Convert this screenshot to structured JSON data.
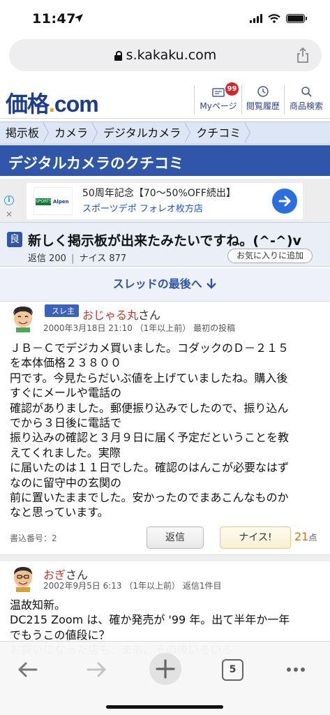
{
  "status": {
    "time": "11:47"
  },
  "browser": {
    "url": "s.kakaku.com",
    "tab_count": "5"
  },
  "site": {
    "logo_kanji": "価格",
    "logo_dot": ".",
    "logo_com": "com",
    "mypage_label": "Myページ",
    "mypage_badge": "99",
    "history_label": "閲覧履歴",
    "search_label": "商品検索"
  },
  "breadcrumb": [
    "掲示板",
    "カメラ",
    "デジタルカメラ",
    "クチコミ"
  ],
  "page_title": "デジタルカメラのクチコミ",
  "ad": {
    "line1": "50周年記念【70〜50%OFF続出】",
    "line2": "スポーツデポ フォレオ枚方店",
    "thumb_left": "SPORTS DEPO",
    "thumb_right": "Alpen"
  },
  "thread": {
    "tag": "良",
    "title": "新しく掲示板が出来たみたいですね。(^-^)v",
    "replies": "返信 200",
    "sep": "|",
    "nice": "ナイス 877",
    "fav_button": "お気に入りに追加"
  },
  "jump_link": "スレッドの最後へ",
  "posts": [
    {
      "badge": "スレ主",
      "name": "おじゃる丸",
      "suffix": "さん",
      "meta": "2000年3月18日 21:10 （1年以上前） 最初の投稿",
      "body": "ＪＢ－Ｃでデジカメ買いました。コダックのＤ－２１５\nを本体価格２３８００\n円です。今見たらだいぶ値を上げていましたね。購入後\nすぐにメールや電話の\n確認がありました。郵便振り込みでしたので、振り込ん\nでから３日後に電話で\n振り込みの確認と３月９日に届く予定だということを教\nえてくれました。実際\nに届いたのは１１日でした。確認のはんこが必要なはず\nなのに留守中の玄関の\n前に置いたままでした。安かったのでまあこんなものか\nなと思っています。",
      "post_no": "書込番号：2",
      "reply_button": "返信",
      "nice_button": "ナイス!",
      "nice_count": "21",
      "nice_unit": "点"
    },
    {
      "name": "おぎ",
      "suffix": "さん",
      "meta": "2002年9月5日 6:13 （1年以上前） 返信1件目",
      "body": "温故知新。\nDC215 Zoom は、確か発売が '99 年。出て半年か一年\nでもうこの値段に？\nお買いになった店も、まあ、その後いろいろ"
    }
  ],
  "colors": {
    "brand": "#2f56a8",
    "name_red": "#c0392b",
    "nice_orange": "#c77a00"
  }
}
